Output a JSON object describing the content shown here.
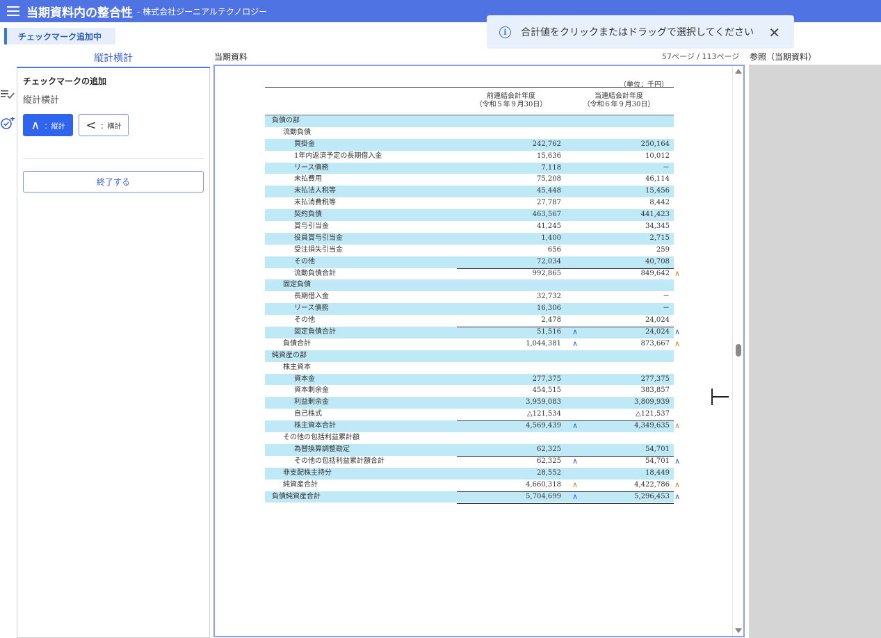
{
  "app": {
    "title": "当期資料内の整合性",
    "company": "- 株式会社ジーニアルテクノロジー",
    "mode_chip": "チェックマーク追加中"
  },
  "toast": {
    "message": "合計値をクリックまたはドラッグで選択してください",
    "close": "✕",
    "icon": "info-icon"
  },
  "left_panel": {
    "tab": "縦計横計",
    "heading": "チェックマークの追加",
    "subheading": "縦計横計",
    "btn_vertical_symbol": "∧",
    "btn_vertical_label": "：縦計",
    "btn_horizontal_symbol": "<",
    "btn_horizontal_label": "：横計",
    "btn_end": "終了する",
    "side_icons": [
      "list-check-icon",
      "add-check-circle-icon"
    ]
  },
  "viewer": {
    "doc_label": "当期資料",
    "page_info": "57ページ / 113ページ",
    "ref_label": "参照（当期資料）"
  },
  "document": {
    "unit": "（単位：千円）",
    "col1_line1": "前連結会計年度",
    "col1_line2": "（令和５年９月30日）",
    "col2_line1": "当連結会計年度",
    "col2_line2": "（令和６年９月30日）",
    "rows": [
      {
        "label": "負債の部",
        "indent": 0,
        "v1": "",
        "v2": ""
      },
      {
        "label": "流動負債",
        "indent": 1,
        "v1": "",
        "v2": ""
      },
      {
        "label": "買掛金",
        "indent": 2,
        "v1": "242,762",
        "v2": "250,164"
      },
      {
        "label": "1年内返済予定の長期借入金",
        "indent": 2,
        "v1": "15,636",
        "v2": "10,012"
      },
      {
        "label": "リース債務",
        "indent": 2,
        "v1": "7,118",
        "v2": "－"
      },
      {
        "label": "未払費用",
        "indent": 2,
        "v1": "75,208",
        "v2": "46,114"
      },
      {
        "label": "未払法人税等",
        "indent": 2,
        "v1": "45,448",
        "v2": "15,456"
      },
      {
        "label": "未払消費税等",
        "indent": 2,
        "v1": "27,787",
        "v2": "8,442"
      },
      {
        "label": "契約負債",
        "indent": 2,
        "v1": "463,567",
        "v2": "441,423"
      },
      {
        "label": "賞与引当金",
        "indent": 2,
        "v1": "41,245",
        "v2": "34,345"
      },
      {
        "label": "役員賞与引当金",
        "indent": 2,
        "v1": "1,400",
        "v2": "2,715"
      },
      {
        "label": "受注損失引当金",
        "indent": 2,
        "v1": "656",
        "v2": "259"
      },
      {
        "label": "その他",
        "indent": 2,
        "v1": "72,034",
        "v2": "40,708"
      },
      {
        "label": "流動負債合計",
        "indent": 2,
        "v1": "992,865",
        "v2": "849,642"
      },
      {
        "label": "固定負債",
        "indent": 1,
        "v1": "",
        "v2": ""
      },
      {
        "label": "長期借入金",
        "indent": 2,
        "v1": "32,732",
        "v2": "－"
      },
      {
        "label": "リース債務",
        "indent": 2,
        "v1": "16,306",
        "v2": "－"
      },
      {
        "label": "その他",
        "indent": 2,
        "v1": "2,478",
        "v2": "24,024"
      },
      {
        "label": "固定負債合計",
        "indent": 2,
        "v1": "51,516",
        "v2": "24,024"
      },
      {
        "label": "負債合計",
        "indent": 1,
        "v1": "1,044,381",
        "v2": "873,667"
      },
      {
        "label": "純資産の部",
        "indent": 0,
        "v1": "",
        "v2": ""
      },
      {
        "label": "株主資本",
        "indent": 1,
        "v1": "",
        "v2": ""
      },
      {
        "label": "資本金",
        "indent": 2,
        "v1": "277,375",
        "v2": "277,375"
      },
      {
        "label": "資本剰余金",
        "indent": 2,
        "v1": "454,515",
        "v2": "383,857"
      },
      {
        "label": "利益剰余金",
        "indent": 2,
        "v1": "3,959,083",
        "v2": "3,809,939"
      },
      {
        "label": "自己株式",
        "indent": 2,
        "v1": "△121,534",
        "v2": "△121,537"
      },
      {
        "label": "株主資本合計",
        "indent": 2,
        "v1": "4,569,439",
        "v2": "4,349,635"
      },
      {
        "label": "その他の包括利益累計額",
        "indent": 1,
        "v1": "",
        "v2": ""
      },
      {
        "label": "為替換算調整勘定",
        "indent": 2,
        "v1": "62,325",
        "v2": "54,701"
      },
      {
        "label": "その他の包括利益累計額合計",
        "indent": 2,
        "v1": "62,325",
        "v2": "54,701"
      },
      {
        "label": "非支配株主持分",
        "indent": 1,
        "v1": "28,552",
        "v2": "18,449"
      },
      {
        "label": "純資産合計",
        "indent": 1,
        "v1": "4,660,318",
        "v2": "4,422,786"
      },
      {
        "label": "負債純資産合計",
        "indent": 0,
        "v1": "5,704,699",
        "v2": "5,296,453"
      }
    ],
    "mark_symbol": "∧",
    "marks": {
      "13": [
        null,
        "orange"
      ],
      "18": [
        "blue",
        "blue"
      ],
      "19": [
        "blue",
        "orange"
      ],
      "26": [
        "blue",
        "orange"
      ],
      "29": [
        "blue",
        "blue"
      ],
      "31": [
        "orange",
        "orange"
      ],
      "32": [
        "blue",
        "blue"
      ]
    },
    "totals": [
      13,
      18,
      26,
      29,
      32
    ]
  }
}
